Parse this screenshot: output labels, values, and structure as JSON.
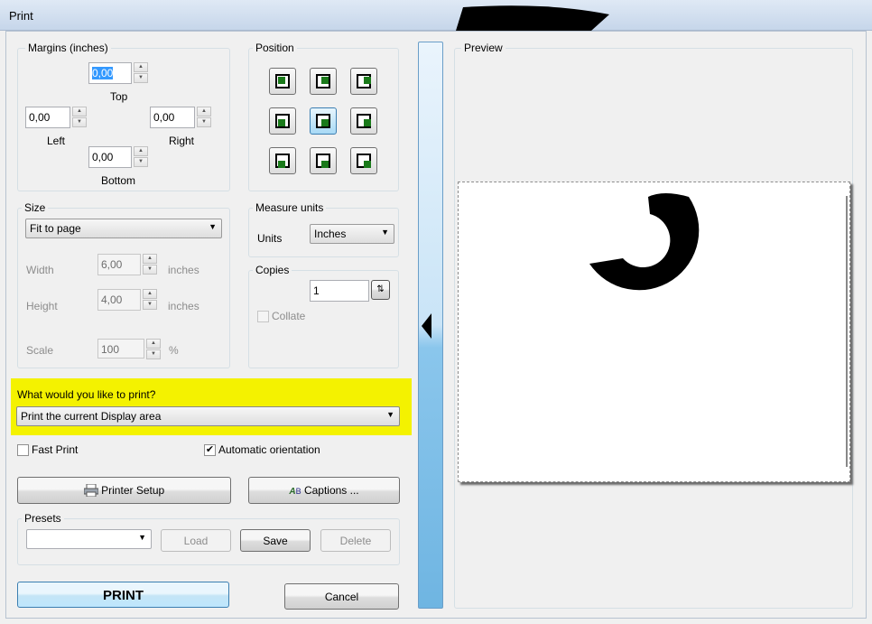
{
  "window": {
    "title": "Print"
  },
  "margins": {
    "group_label": "Margins (inches)",
    "top": "0,00",
    "top_label": "Top",
    "left": "0,00",
    "left_label": "Left",
    "right": "0,00",
    "right_label": "Right",
    "bottom": "0,00",
    "bottom_label": "Bottom"
  },
  "position": {
    "group_label": "Position",
    "selected": "middle-center"
  },
  "size": {
    "group_label": "Size",
    "mode": "Fit to page",
    "width_label": "Width",
    "width": "6,00",
    "height_label": "Height",
    "height": "4,00",
    "unit": "inches",
    "scale_label": "Scale",
    "scale": "100",
    "scale_unit": "%"
  },
  "measure": {
    "group_label": "Measure units",
    "units_label": "Units",
    "units": "Inches"
  },
  "copies": {
    "group_label": "Copies",
    "count": "1",
    "collate_label": "Collate",
    "collate_checked": false
  },
  "print_what": {
    "label": "What would you like to print?",
    "value": "Print the current Display area",
    "highlight_color": "#f4f200"
  },
  "options": {
    "fast_print_label": "Fast Print",
    "fast_print_checked": false,
    "auto_orient_label": "Automatic orientation",
    "auto_orient_checked": true
  },
  "buttons": {
    "printer_setup": "Printer Setup",
    "captions": "Captions ...",
    "print": "PRINT",
    "cancel": "Cancel"
  },
  "presets": {
    "group_label": "Presets",
    "selected": "",
    "load": "Load",
    "save": "Save",
    "delete": "Delete"
  },
  "preview": {
    "group_label": "Preview"
  },
  "icons": {
    "printer": "printer-icon",
    "captions": "captions-icon",
    "collapse": "collapse-left-icon"
  }
}
